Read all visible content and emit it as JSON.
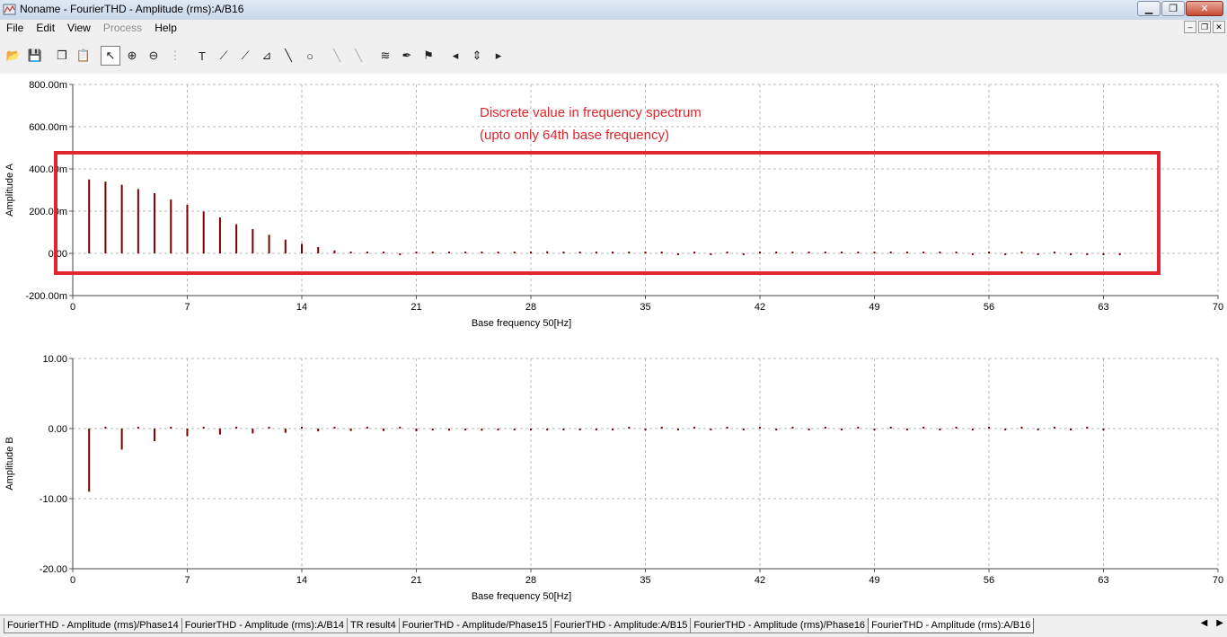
{
  "window": {
    "title": "Noname - FourierTHD - Amplitude (rms):A/B16",
    "minimize_icon": "minimize-icon",
    "maximize_icon": "maximize-icon",
    "close_icon": "close-icon"
  },
  "menu": {
    "items": [
      {
        "label": "File",
        "enabled": true
      },
      {
        "label": "Edit",
        "enabled": true
      },
      {
        "label": "View",
        "enabled": true
      },
      {
        "label": "Process",
        "enabled": false
      },
      {
        "label": "Help",
        "enabled": true
      }
    ]
  },
  "toolbar": {
    "tools": [
      {
        "name": "open-folder-icon",
        "glyph": "📂",
        "group": 1
      },
      {
        "name": "save-icon",
        "glyph": "💾",
        "group": 1
      },
      {
        "name": "copy-icon",
        "glyph": "❐",
        "group": 2
      },
      {
        "name": "paste-icon",
        "glyph": "📋",
        "group": 2
      },
      {
        "name": "pointer-icon",
        "glyph": "↖",
        "group": 3,
        "pressed": true
      },
      {
        "name": "zoom-in-icon",
        "glyph": "⊕",
        "group": 3
      },
      {
        "name": "zoom-100-icon",
        "glyph": "⊖",
        "group": 3
      },
      {
        "name": "grid-dots-icon",
        "glyph": "⋮",
        "group": 3,
        "disabled": true
      },
      {
        "name": "text-tool-icon",
        "glyph": "T",
        "group": 4
      },
      {
        "name": "marker-icon",
        "glyph": "⟋",
        "group": 4
      },
      {
        "name": "marker-2-icon",
        "glyph": "⟋",
        "group": 4
      },
      {
        "name": "scale-icon",
        "glyph": "⊿",
        "group": 4
      },
      {
        "name": "line-tool-icon",
        "glyph": "╲",
        "group": 4
      },
      {
        "name": "circle-tool-icon",
        "glyph": "○",
        "group": 4
      },
      {
        "name": "cursor-a-icon",
        "glyph": "╲",
        "group": 5,
        "disabled": true
      },
      {
        "name": "cursor-b-icon",
        "glyph": "╲",
        "group": 5,
        "disabled": true
      },
      {
        "name": "add-trace-icon",
        "glyph": "≋",
        "group": 6
      },
      {
        "name": "probe-icon",
        "glyph": "✒",
        "group": 6
      },
      {
        "name": "flag-icon",
        "glyph": "⚑",
        "group": 6
      },
      {
        "name": "arrow-left-icon",
        "glyph": "◂",
        "group": 7
      },
      {
        "name": "arrow-updown-icon",
        "glyph": "⇕",
        "group": 7
      },
      {
        "name": "arrow-right-icon",
        "glyph": "▸",
        "group": 7
      }
    ]
  },
  "annotation": {
    "line1": "Discrete value in frequency spectrum",
    "line2": "(upto only 64th base frequency)",
    "color": "#e0262e"
  },
  "chart_data": [
    {
      "type": "bar",
      "ylabel": "Amplitude A",
      "xlabel": "Base frequency 50[Hz]",
      "xlim": [
        0,
        70
      ],
      "ylim": [
        -200,
        800
      ],
      "xticks": [
        "0",
        "7",
        "14",
        "21",
        "28",
        "35",
        "42",
        "49",
        "56",
        "63",
        "70"
      ],
      "yticks": [
        "800.00m",
        "600.00m",
        "400.00m",
        "200.00m",
        "0.00",
        "-200.00m"
      ],
      "grid": true,
      "bar_color": "#7a0000",
      "x": [
        1,
        2,
        3,
        4,
        5,
        6,
        7,
        8,
        9,
        10,
        11,
        12,
        13,
        14,
        15,
        16,
        17,
        18,
        19,
        20,
        21,
        22,
        23,
        24,
        25,
        26,
        27,
        28,
        29,
        30,
        31,
        32,
        33,
        34,
        35,
        36,
        37,
        38,
        39,
        40,
        41,
        42,
        43,
        44,
        45,
        46,
        47,
        48,
        49,
        50,
        51,
        52,
        53,
        54,
        55,
        56,
        57,
        58,
        59,
        60,
        61,
        62,
        63,
        64
      ],
      "values": [
        350,
        340,
        325,
        305,
        285,
        255,
        230,
        198,
        170,
        138,
        115,
        88,
        65,
        45,
        30,
        14,
        8,
        3,
        2,
        -4,
        1,
        1,
        3,
        5,
        6,
        7,
        8,
        9,
        10,
        8,
        6,
        5,
        4,
        3,
        2,
        1,
        -4,
        1,
        -4,
        1,
        -4,
        1,
        1,
        1,
        1,
        4,
        1,
        1,
        3,
        1,
        4,
        1,
        3,
        1,
        -1,
        1,
        -2,
        1,
        -2,
        1,
        -2,
        -1,
        -1,
        -3
      ]
    },
    {
      "type": "bar",
      "ylabel": "Amplitude B",
      "xlabel": "Base frequency 50[Hz]",
      "xlim": [
        0,
        70
      ],
      "ylim": [
        -20,
        10
      ],
      "xticks": [
        "0",
        "7",
        "14",
        "21",
        "28",
        "35",
        "42",
        "49",
        "56",
        "63",
        "70"
      ],
      "yticks": [
        "10.00",
        "0.00",
        "-10.00",
        "-20.00"
      ],
      "grid": true,
      "bar_color": "#7a0000",
      "x": [
        1,
        2,
        3,
        4,
        5,
        6,
        7,
        8,
        9,
        10,
        11,
        12,
        13,
        14,
        15,
        16,
        17,
        18,
        19,
        20,
        21,
        22,
        23,
        24,
        25,
        26,
        27,
        28,
        29,
        30,
        31,
        32,
        33,
        34,
        35,
        36,
        37,
        38,
        39,
        40,
        41,
        42,
        43,
        44,
        45,
        46,
        47,
        48,
        49,
        50,
        51,
        52,
        53,
        54,
        55,
        56,
        57,
        58,
        59,
        60,
        61,
        62,
        63
      ],
      "values": [
        -9.0,
        0.15,
        -3.0,
        0.2,
        -1.8,
        0.2,
        -1.1,
        0.2,
        -0.85,
        0.15,
        -0.7,
        0.12,
        -0.6,
        0.1,
        -0.4,
        0.1,
        -0.35,
        0.1,
        -0.35,
        0.1,
        -0.4,
        -0.1,
        -0.3,
        -0.1,
        -0.3,
        -0.1,
        -0.25,
        -0.1,
        -0.25,
        -0.1,
        -0.2,
        -0.1,
        -0.2,
        0.1,
        -0.1,
        0.1,
        -0.1,
        0.05,
        -0.1,
        0.05,
        -0.05,
        0.05,
        -0.05,
        0.05,
        -0.05,
        0.05,
        -0.05,
        0.05,
        -0.05,
        0.05,
        -0.05,
        0.05,
        -0.05,
        0.05,
        -0.05,
        0.05,
        -0.05,
        0.05,
        -0.05,
        0.05,
        -0.05,
        0.05,
        -0.05
      ]
    }
  ],
  "tabs": [
    {
      "label": "FourierTHD - Amplitude (rms)/Phase14",
      "active": false
    },
    {
      "label": "FourierTHD - Amplitude (rms):A/B14",
      "active": false
    },
    {
      "label": "TR result4",
      "active": false
    },
    {
      "label": "FourierTHD - Amplitude/Phase15",
      "active": false
    },
    {
      "label": "FourierTHD - Amplitude:A/B15",
      "active": false
    },
    {
      "label": "FourierTHD - Amplitude (rms)/Phase16",
      "active": false
    },
    {
      "label": "FourierTHD - Amplitude (rms):A/B16",
      "active": true
    }
  ]
}
